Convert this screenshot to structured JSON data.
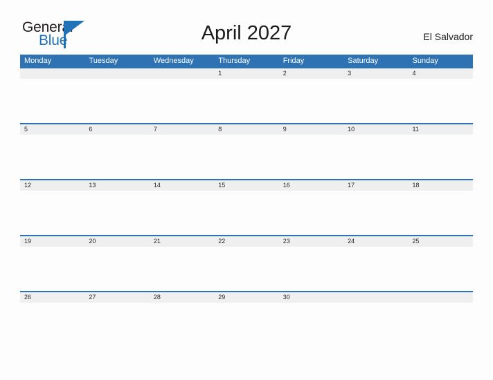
{
  "brand": {
    "name_part1": "General",
    "name_part2": "Blue",
    "triangle_icon": "triangle-icon",
    "accent_color": "#2072b8"
  },
  "header": {
    "title": "April 2027",
    "country": "El Salvador"
  },
  "colors": {
    "header_blue": "#2e72b3",
    "row_divider_blue": "#2e72b3",
    "daynum_band_gray": "#efefef",
    "page_background": "#fdfdfd",
    "text_dark": "#1a1a1a"
  },
  "calendar": {
    "weekday_headers": [
      "Monday",
      "Tuesday",
      "Wednesday",
      "Thursday",
      "Friday",
      "Saturday",
      "Sunday"
    ],
    "weeks": [
      [
        "",
        "",
        "",
        "1",
        "2",
        "3",
        "4"
      ],
      [
        "5",
        "6",
        "7",
        "8",
        "9",
        "10",
        "11"
      ],
      [
        "12",
        "13",
        "14",
        "15",
        "16",
        "17",
        "18"
      ],
      [
        "19",
        "20",
        "21",
        "22",
        "23",
        "24",
        "25"
      ],
      [
        "26",
        "27",
        "28",
        "29",
        "30",
        "",
        ""
      ]
    ]
  }
}
